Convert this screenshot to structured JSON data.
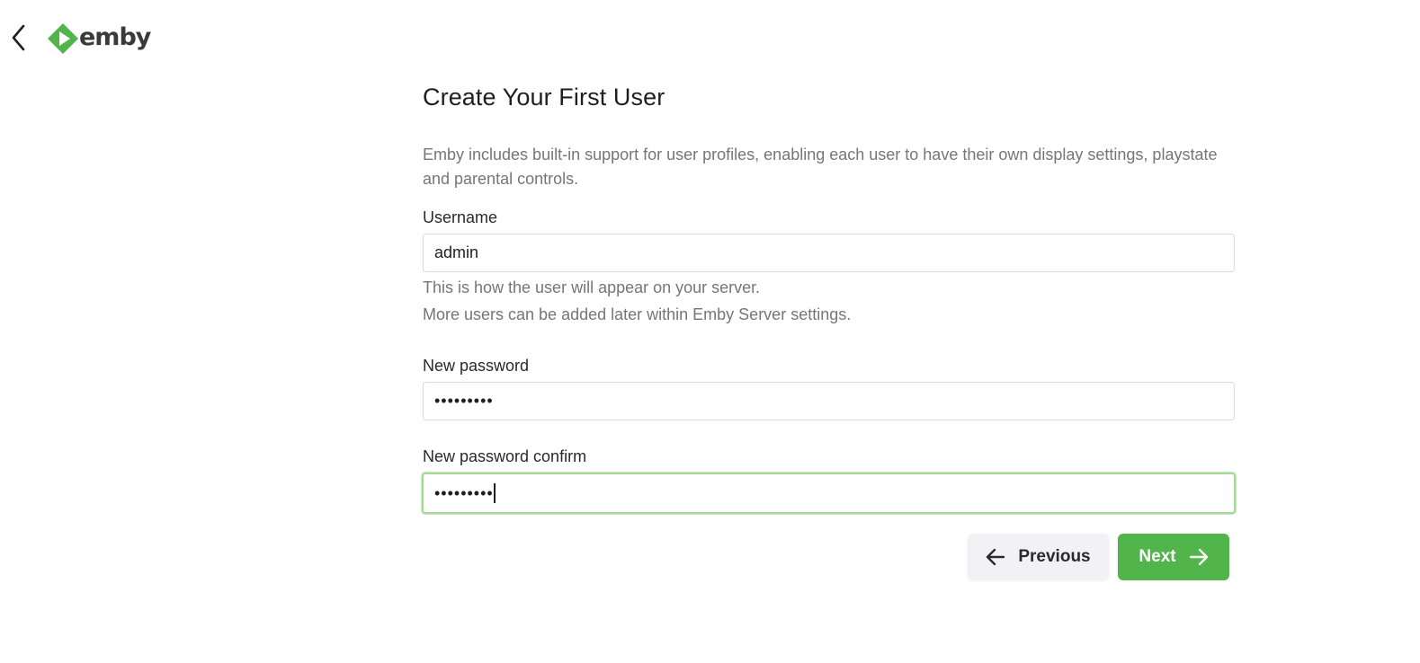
{
  "header": {
    "back_icon": "chevron-left-icon",
    "logo_text": "emby",
    "brand_color": "#52b54b"
  },
  "page": {
    "title": "Create Your First User",
    "intro": "Emby includes built-in support for user profiles, enabling each user to have their own display settings, playstate and parental controls."
  },
  "form": {
    "username": {
      "label": "Username",
      "value": "admin",
      "help1": "This is how the user will appear on your server.",
      "help2": "More users can be added later within Emby Server settings."
    },
    "password": {
      "label": "New password",
      "masked_value": "•••••••••"
    },
    "password_confirm": {
      "label": "New password confirm",
      "masked_value": "•••••••••"
    }
  },
  "buttons": {
    "previous_label": "Previous",
    "previous_icon": "arrow-left-icon",
    "next_label": "Next",
    "next_icon": "arrow-right-icon"
  }
}
